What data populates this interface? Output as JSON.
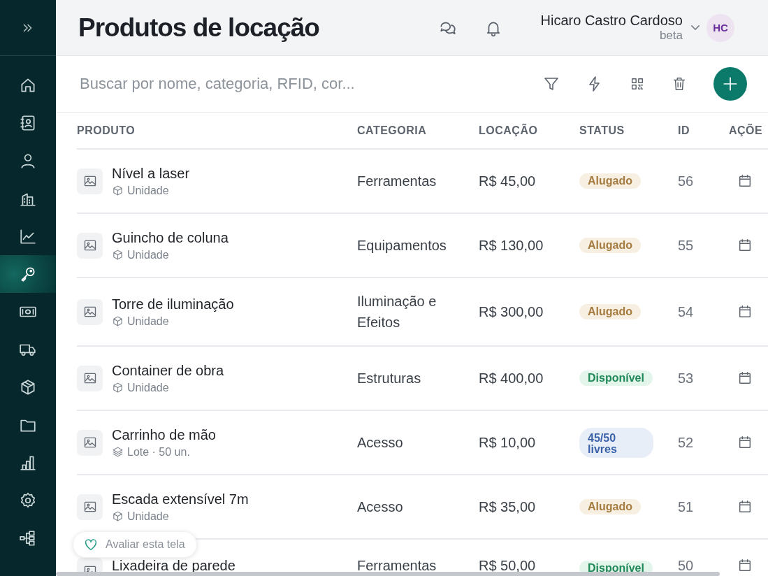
{
  "sidebar": {
    "items": [
      {
        "selected": false
      },
      {
        "selected": false
      },
      {
        "selected": false
      },
      {
        "selected": false
      },
      {
        "selected": false
      },
      {
        "selected": true
      },
      {
        "selected": false
      },
      {
        "selected": false
      },
      {
        "selected": false
      },
      {
        "selected": false
      },
      {
        "selected": false
      },
      {
        "selected": false
      },
      {
        "selected": false
      }
    ]
  },
  "header": {
    "title": "Produtos de locação",
    "user": {
      "name": "Hicaro Castro Cardoso",
      "plan": "beta",
      "initials": "HC"
    }
  },
  "toolbar": {
    "search": {
      "placeholder": "Buscar por nome, categoria, RFID, cor..."
    }
  },
  "table": {
    "columns": [
      "PRODUTO",
      "CATEGORIA",
      "LOCAÇÃO",
      "STATUS",
      "ID",
      "AÇÕE"
    ],
    "rows": [
      {
        "name": "Nível a laser",
        "unit": {
          "kind": "unit",
          "text": "Unidade"
        },
        "category": "Ferramentas",
        "price": "R$ 45,00",
        "status": {
          "text": "Alugado",
          "kind": "rented"
        },
        "id": "56"
      },
      {
        "name": "Guincho de coluna",
        "unit": {
          "kind": "unit",
          "text": "Unidade"
        },
        "category": "Equipamentos",
        "price": "R$ 130,00",
        "status": {
          "text": "Alugado",
          "kind": "rented"
        },
        "id": "55"
      },
      {
        "name": "Torre de iluminação",
        "unit": {
          "kind": "unit",
          "text": "Unidade"
        },
        "category": "Iluminação e Efeitos",
        "price": "R$ 300,00",
        "status": {
          "text": "Alugado",
          "kind": "rented"
        },
        "id": "54"
      },
      {
        "name": "Container de obra",
        "unit": {
          "kind": "unit",
          "text": "Unidade"
        },
        "category": "Estruturas",
        "price": "R$ 400,00",
        "status": {
          "text": "Disponível",
          "kind": "available"
        },
        "id": "53"
      },
      {
        "name": "Carrinho de mão",
        "unit": {
          "kind": "lot",
          "text": "Lote · 50 un."
        },
        "category": "Acesso",
        "price": "R$ 10,00",
        "status": {
          "text": "45/50 livres",
          "kind": "partial"
        },
        "id": "52"
      },
      {
        "name": "Escada extensível 7m",
        "unit": {
          "kind": "unit",
          "text": "Unidade"
        },
        "category": "Acesso",
        "price": "R$ 35,00",
        "status": {
          "text": "Alugado",
          "kind": "rented"
        },
        "id": "51"
      },
      {
        "name": "Lixadeira de parede",
        "category": "Ferramentas",
        "price": "R$ 50,00",
        "status": {
          "text": "Disponível",
          "kind": "available"
        },
        "id": "50"
      }
    ]
  },
  "feedback": {
    "label": "Avaliar esta tela"
  }
}
